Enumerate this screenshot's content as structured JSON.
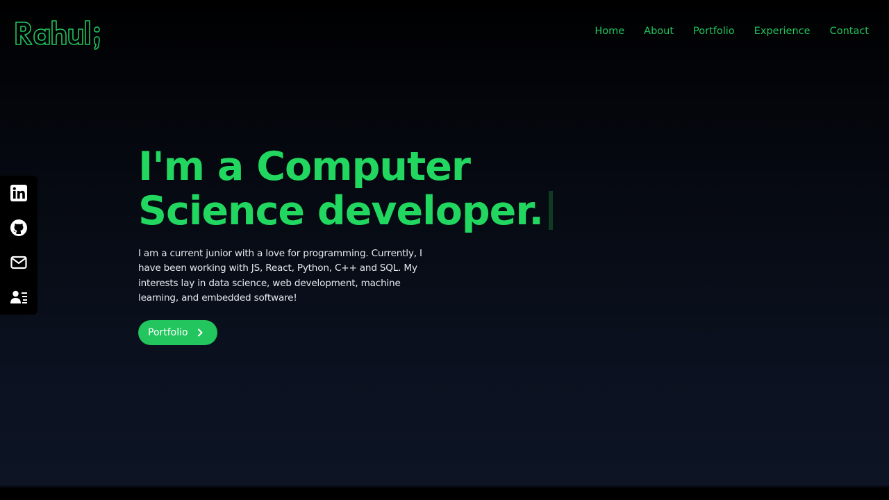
{
  "brand": {
    "logo_text": "Rahul;",
    "accent_color": "#22c55e"
  },
  "nav": {
    "items": [
      {
        "label": "Home"
      },
      {
        "label": "About"
      },
      {
        "label": "Portfolio"
      },
      {
        "label": "Experience"
      },
      {
        "label": "Contact"
      }
    ]
  },
  "socials": {
    "items": [
      {
        "icon": "linkedin-icon"
      },
      {
        "icon": "github-icon"
      },
      {
        "icon": "mail-icon"
      },
      {
        "icon": "resume-icon"
      }
    ]
  },
  "hero": {
    "headline_line1": "I'm a Computer",
    "headline_line2": "Science developer.",
    "description": "I am a current junior with a love for programming. Currently, I have been working with JS, React, Python, C++ and SQL. My interests lay in data science, web development, machine learning, and embedded software!",
    "cta_label": "Portfolio"
  }
}
